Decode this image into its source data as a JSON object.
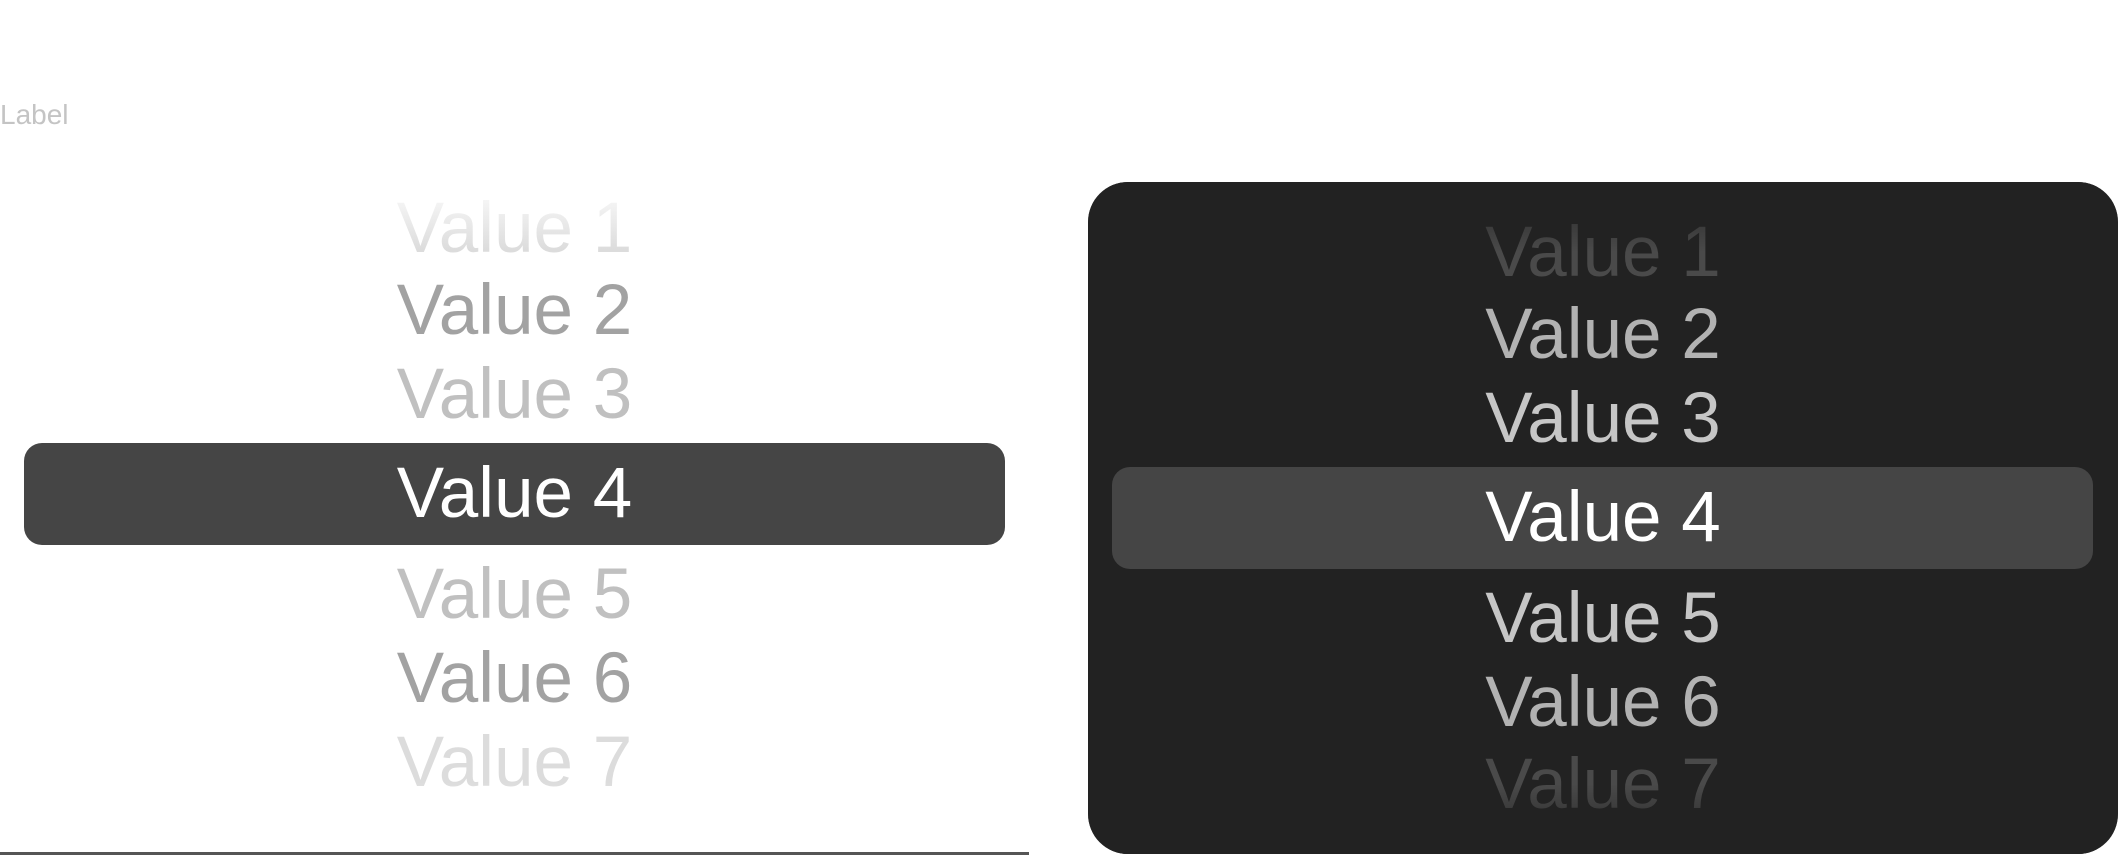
{
  "label": "Label",
  "options": [
    "Value 1",
    "Value 2",
    "Value 3",
    "Value 4",
    "Value 5",
    "Value 6",
    "Value 7"
  ],
  "selected_option": "Value 4",
  "colors": {
    "dark_surface": "#222222",
    "highlight": "#454545",
    "label_text": "#c4c4c4",
    "underline": "#555555"
  }
}
